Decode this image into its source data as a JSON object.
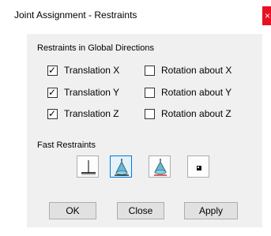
{
  "window": {
    "title": "Joint Assignment - Restraints",
    "close_glyph": "×"
  },
  "global_group": {
    "label": "Restraints in Global Directions",
    "items": [
      {
        "label": "Translation  X",
        "checked": true
      },
      {
        "label": "Translation  Y",
        "checked": true
      },
      {
        "label": "Translation  Z",
        "checked": true
      },
      {
        "label": "Rotation about  X",
        "checked": false
      },
      {
        "label": "Rotation about  Y",
        "checked": false
      },
      {
        "label": "Rotation about  Z",
        "checked": false
      }
    ]
  },
  "fast_group": {
    "label": "Fast Restraints",
    "buttons": [
      {
        "icon": "fixed-support-icon"
      },
      {
        "icon": "pinned-support-icon"
      },
      {
        "icon": "roller-support-icon"
      },
      {
        "icon": "free-joint-icon"
      }
    ]
  },
  "buttons": {
    "ok": "OK",
    "close": "Close",
    "apply": "Apply"
  },
  "colors": {
    "close_button": "#e81123",
    "dialog_bg": "#f0f0f0",
    "focus_border": "#0078d7"
  }
}
